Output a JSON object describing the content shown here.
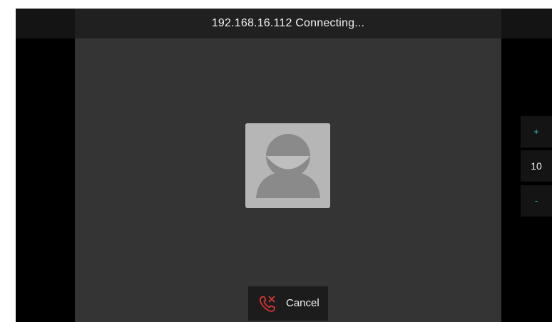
{
  "call": {
    "title": "192.168.16.112  Connecting..."
  },
  "avatar": {
    "icon": "default-user-avatar-icon"
  },
  "cancel": {
    "label": "Cancel",
    "icon": "hang-up-phone-icon",
    "icon_color": "#e53935"
  },
  "volume": {
    "increase_label": "+",
    "value": "10",
    "decrease_label": "-",
    "accent_color": "#28c0c0"
  },
  "colors": {
    "background": "#000000",
    "video_area": "#343434",
    "title_bar": "#202020",
    "avatar_bg": "#b6b6b6"
  }
}
